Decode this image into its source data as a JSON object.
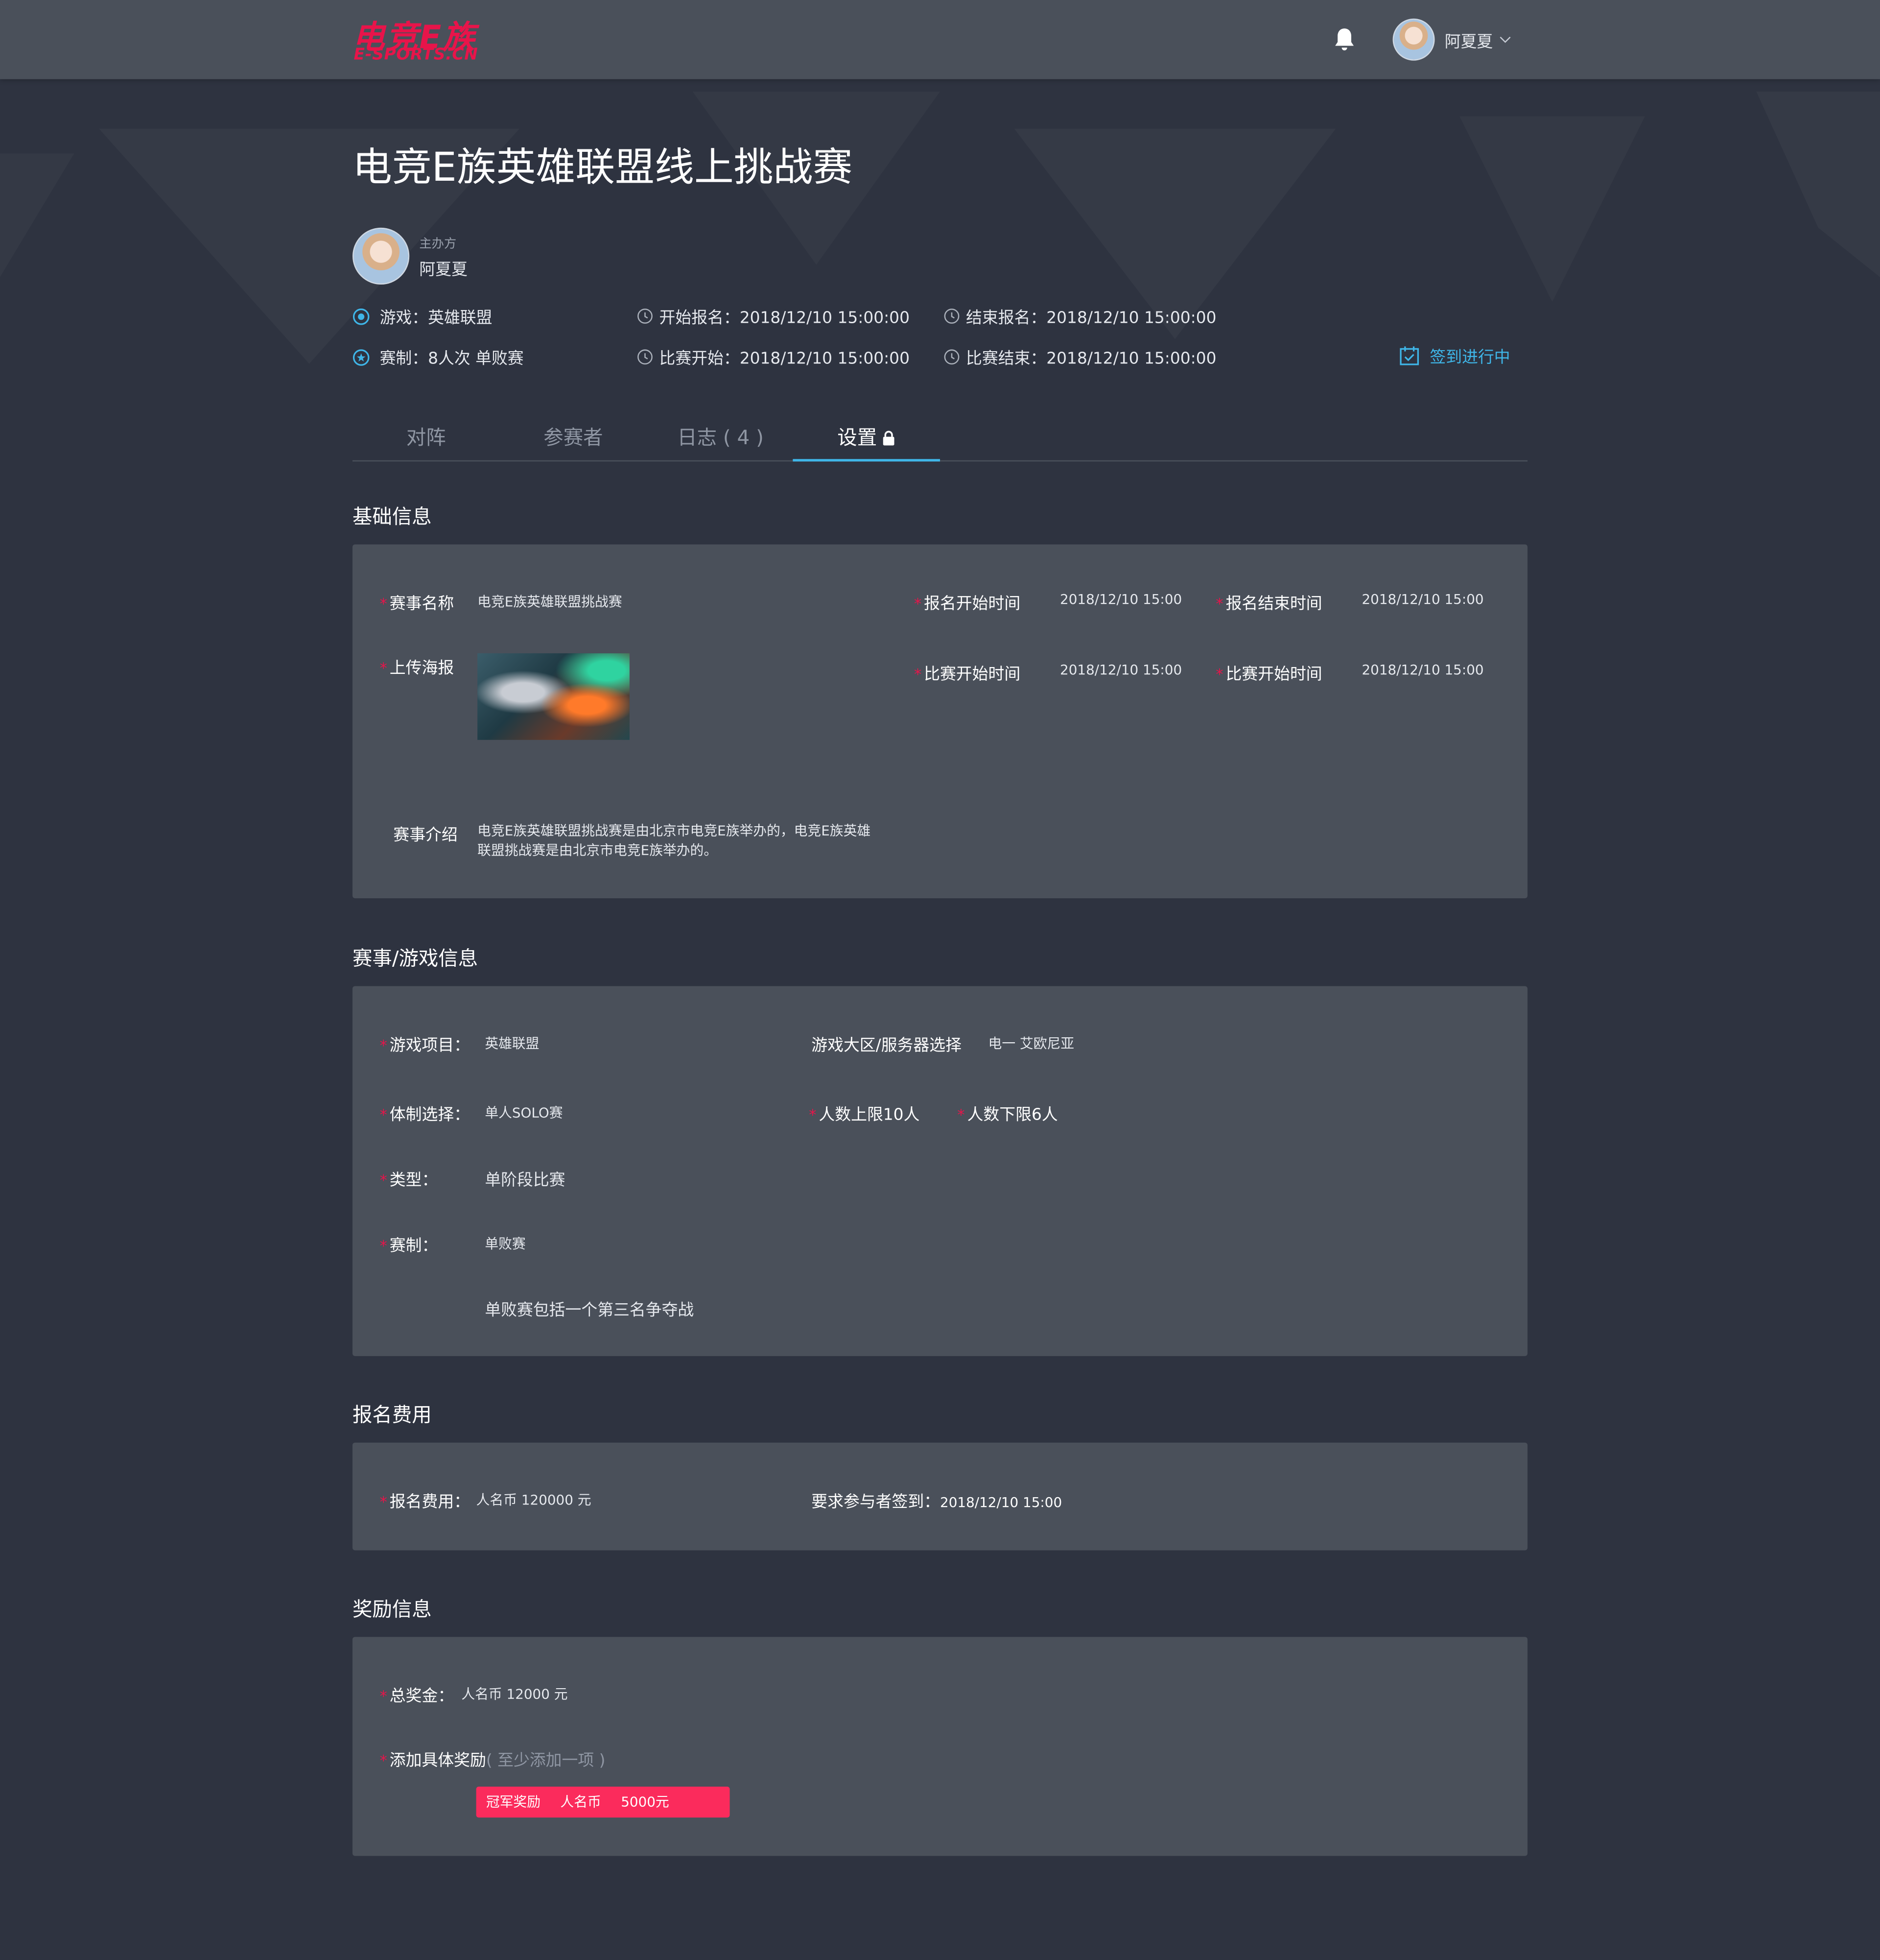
{
  "header": {
    "logo_cn": "电竞E族",
    "logo_en": "E-SPORTS.CN",
    "user_name": "阿夏夏"
  },
  "event": {
    "title": "电竞E族英雄联盟线上挑战赛",
    "host_role": "主办方",
    "host_name": "阿夏夏",
    "game": "游戏：英雄联盟",
    "format": "赛制：8人次  单败赛",
    "reg_start": "开始报名：2018/12/10  15:00:00",
    "reg_end": "结束报名：2018/12/10  15:00:00",
    "match_start": "比赛开始：2018/12/10  15:00:00",
    "match_end": "比赛结束：2018/12/10  15:00:00",
    "checkin_status": "签到进行中"
  },
  "tabs": [
    {
      "label": "对阵"
    },
    {
      "label": "参赛者"
    },
    {
      "label": "日志 ( 4 )"
    },
    {
      "label": "设置"
    }
  ],
  "basic": {
    "section_title": "基础信息",
    "name_label": "赛事名称",
    "name_value": "电竞E族英雄联盟挑战赛",
    "poster_label": "上传海报",
    "reg_start_label": "报名开始时间",
    "reg_start_value": "2018/12/10  15:00",
    "reg_end_label": "报名结束时间",
    "reg_end_value": "2018/12/10  15:00",
    "match_start_label": "比赛开始时间",
    "match_start_value": "2018/12/10  15:00",
    "match_start_label2": "比赛开始时间",
    "match_start_value2": "2018/12/10  15:00",
    "intro_label": "赛事介绍",
    "intro_value": "电竞E族英雄联盟挑战赛是由北京市电竞E族举办的，电竞E族英雄联盟挑战赛是由北京市电竞E族举办的。"
  },
  "game_info": {
    "section_title": "赛事/游戏信息",
    "game_label": "游戏项目：",
    "game_value": "英雄联盟",
    "server_label": "游戏大区/服务器选择",
    "server_value": "电一  艾欧尼亚",
    "system_label": "体制选择：",
    "system_value": "单人SOLO赛",
    "max_label": "人数上限10人",
    "min_label": "人数下限6人",
    "type_label": "类型：",
    "type_value": "单阶段比赛",
    "format_label": "赛制：",
    "format_value": "单败赛",
    "format_note": "单败赛包括一个第三名争夺战"
  },
  "fee": {
    "section_title": "报名费用",
    "fee_label": "报名费用：",
    "fee_value": "人名币    120000 元",
    "checkin_text": "要求参与者签到：",
    "checkin_value": "2018/12/10  15:00"
  },
  "reward": {
    "section_title": "奖励信息",
    "total_label": "总奖金：",
    "total_value": "人名币    12000 元",
    "add_label": "添加具体奖励",
    "add_hint": "( 至少添加一项 )",
    "tag_name": "冠军奖励",
    "tag_currency": "人名币",
    "tag_amount": "5000元"
  },
  "colors": {
    "accent": "#3fb6e8",
    "brand": "#e8144a",
    "tag": "#fb2b5c",
    "panel": "#4a505a",
    "page": "#2e3340"
  }
}
